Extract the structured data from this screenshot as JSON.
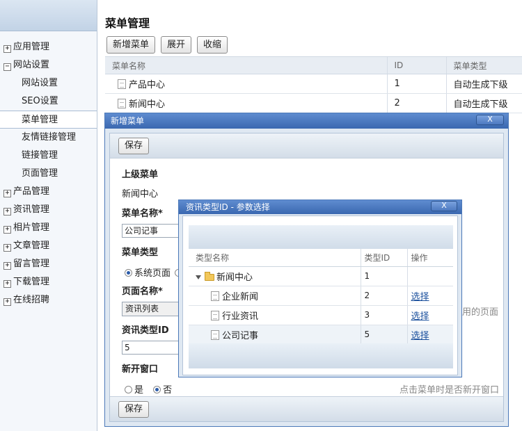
{
  "sidebar": {
    "items": [
      {
        "label": "应用管理",
        "marker": "+"
      },
      {
        "label": "网站设置",
        "marker": "−"
      },
      {
        "label": "网站设置"
      },
      {
        "label": "SEO设置"
      },
      {
        "label": "菜单管理"
      },
      {
        "label": "友情链接管理"
      },
      {
        "label": "链接管理"
      },
      {
        "label": "页面管理"
      },
      {
        "label": "产品管理",
        "marker": "+"
      },
      {
        "label": "资讯管理",
        "marker": "+"
      },
      {
        "label": "相片管理",
        "marker": "+"
      },
      {
        "label": "文章管理",
        "marker": "+"
      },
      {
        "label": "留言管理",
        "marker": "+"
      },
      {
        "label": "下载管理",
        "marker": "+"
      },
      {
        "label": "在线招聘",
        "marker": "+"
      }
    ]
  },
  "main": {
    "title": "菜单管理",
    "toolbar": {
      "add_label": "新增菜单",
      "expand_label": "展开",
      "collapse_label": "收缩"
    },
    "table": {
      "columns": [
        "菜单名称",
        "ID",
        "菜单类型"
      ],
      "rows": [
        {
          "name": "产品中心",
          "id": "1",
          "type": "自动生成下级"
        },
        {
          "name": "新闻中心",
          "id": "2",
          "type": "自动生成下级"
        }
      ]
    }
  },
  "dialog_add": {
    "title": "新增菜单",
    "close": "X",
    "save_label": "保存",
    "parent_label": "上级菜单",
    "parent_value": "新闻中心",
    "name_label": "菜单名称*",
    "name_value": "公司记事",
    "type_label": "菜单类型",
    "type_option_system": "系统页面",
    "page_label": "页面名称*",
    "page_value": "资讯列表",
    "page_hint": "用的页面",
    "news_type_label": "资讯类型ID",
    "news_type_value": "5",
    "new_window_label": "新开窗口",
    "yes": "是",
    "no": "否",
    "new_window_hint": "点击菜单时是否新开窗口"
  },
  "dialog_pick": {
    "title": "资讯类型ID - 参数选择",
    "close": "X",
    "columns": [
      "类型名称",
      "类型ID",
      "操作"
    ],
    "root": {
      "name": "新闻中心",
      "id": "1"
    },
    "rows": [
      {
        "name": "企业新闻",
        "id": "2",
        "action": "选择"
      },
      {
        "name": "行业资讯",
        "id": "3",
        "action": "选择"
      },
      {
        "name": "公司记事",
        "id": "5",
        "action": "选择"
      }
    ]
  }
}
